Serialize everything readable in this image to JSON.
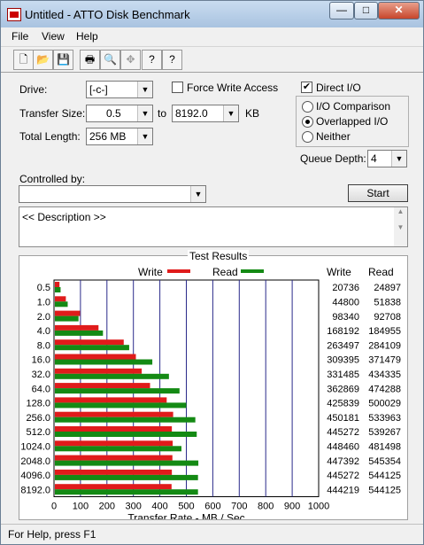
{
  "window": {
    "title": "Untitled - ATTO Disk Benchmark",
    "minimize": "—",
    "maximize": "□",
    "close": "✕"
  },
  "menu": [
    "File",
    "View",
    "Help"
  ],
  "toolbar": [
    {
      "name": "new-icon",
      "glyph": "🗋",
      "disabled": false
    },
    {
      "name": "open-icon",
      "glyph": "📂",
      "disabled": false
    },
    {
      "name": "save-icon",
      "glyph": "💾",
      "disabled": false
    },
    {
      "name": "print-icon",
      "glyph": "🖶",
      "disabled": false
    },
    {
      "name": "print-preview-icon",
      "glyph": "🔍",
      "disabled": false
    },
    {
      "name": "move-icon",
      "glyph": "✥",
      "disabled": true
    },
    {
      "name": "help-icon",
      "glyph": "?",
      "disabled": false
    },
    {
      "name": "context-help-icon",
      "glyph": "?",
      "disabled": false
    }
  ],
  "form": {
    "drive_label": "Drive:",
    "drive_value": "[-c-]",
    "force_write_label": "Force Write Access",
    "force_write_checked": false,
    "direct_io_label": "Direct I/O",
    "direct_io_checked": true,
    "transfer_size_label": "Transfer Size:",
    "transfer_from": "0.5",
    "to_label": "to",
    "transfer_to": "8192.0",
    "kb_label": "KB",
    "total_length_label": "Total Length:",
    "total_length": "256 MB",
    "io_comparison": "I/O Comparison",
    "overlapped_io": "Overlapped I/O",
    "neither": "Neither",
    "queue_depth_label": "Queue Depth:",
    "queue_depth": "4",
    "controlled_by_label": "Controlled by:",
    "controlled_by": "",
    "start_label": "Start",
    "description": "<< Description >>"
  },
  "results": {
    "title": "Test Results",
    "write_legend": "Write",
    "read_legend": "Read",
    "write_header": "Write",
    "read_header": "Read",
    "write_color": "#e01b1b",
    "read_color": "#148a14"
  },
  "chart_data": {
    "type": "bar",
    "orientation": "horizontal",
    "title": "Test Results",
    "xlabel": "Transfer Rate - MB / Sec",
    "xlim": [
      0,
      1000
    ],
    "xticks": [
      "0",
      "100",
      "200",
      "300",
      "400",
      "500",
      "600",
      "700",
      "800",
      "900",
      "1000"
    ],
    "categories": [
      "0.5",
      "1.0",
      "2.0",
      "4.0",
      "8.0",
      "16.0",
      "32.0",
      "64.0",
      "128.0",
      "256.0",
      "512.0",
      "1024.0",
      "2048.0",
      "4096.0",
      "8192.0"
    ],
    "series": [
      {
        "name": "Write",
        "values": [
          20.7,
          44.8,
          98.3,
          168.2,
          263.5,
          309.4,
          331.5,
          362.9,
          425.8,
          450.2,
          445.3,
          448.5,
          447.4,
          445.3,
          444.2
        ]
      },
      {
        "name": "Read",
        "values": [
          24.9,
          51.8,
          92.7,
          185.0,
          284.1,
          371.5,
          434.3,
          474.3,
          500.0,
          534.0,
          539.3,
          481.5,
          545.4,
          544.1,
          544.1
        ]
      }
    ],
    "write_kb": [
      "20736",
      "44800",
      "98340",
      "168192",
      "263497",
      "309395",
      "331485",
      "362869",
      "425839",
      "450181",
      "445272",
      "448460",
      "447392",
      "445272",
      "444219"
    ],
    "read_kb": [
      "24897",
      "51838",
      "92708",
      "184955",
      "284109",
      "371479",
      "434335",
      "474288",
      "500029",
      "533963",
      "539267",
      "481498",
      "545354",
      "544125",
      "544125"
    ]
  },
  "status": "For Help, press F1"
}
